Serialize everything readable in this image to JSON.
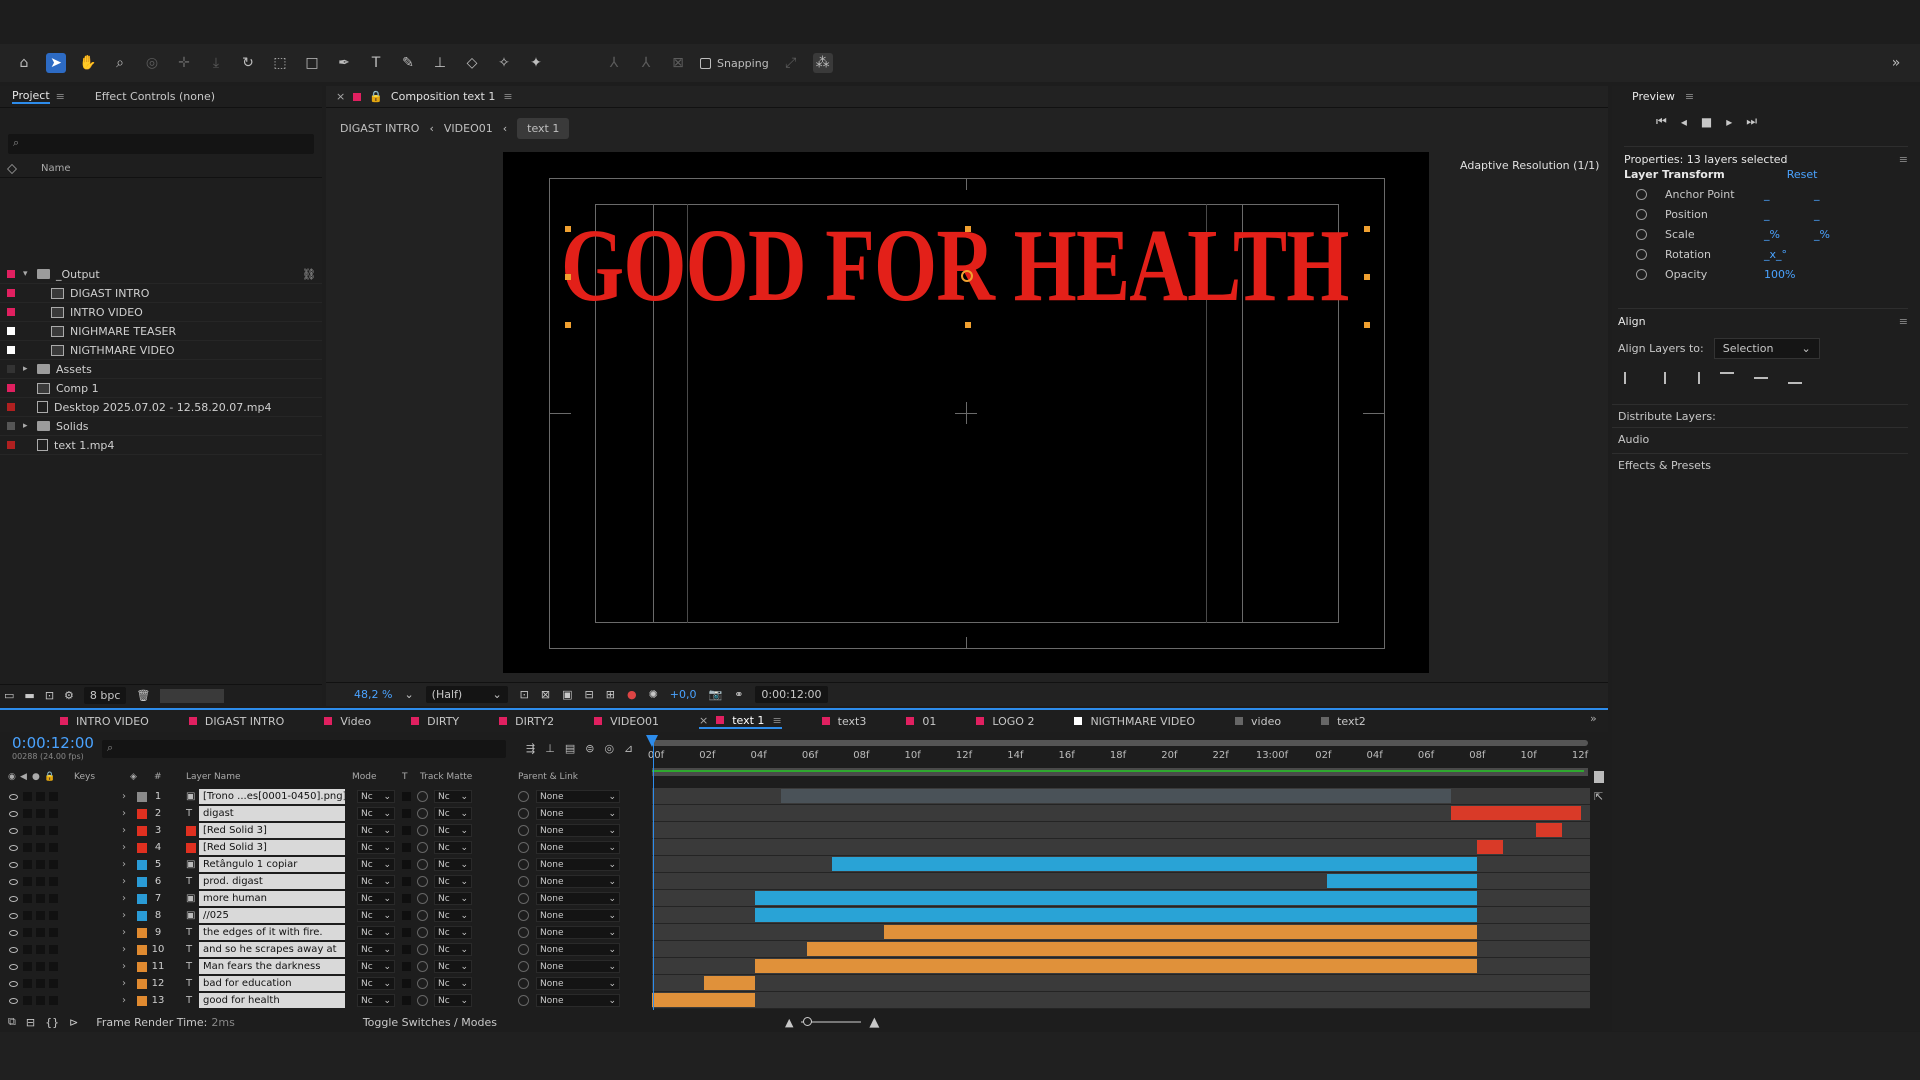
{
  "toolbar": {
    "snapping_label": "Snapping",
    "tools": [
      "home-icon",
      "selection-arrow-icon",
      "hand-icon",
      "zoom-icon",
      "orbit-icon",
      "pan-behind-icon",
      "dolly-icon",
      "rotate-icon",
      "region-icon",
      "rectangle-icon",
      "pen-icon",
      "type-icon",
      "brush-icon",
      "clone-stamp-icon",
      "eraser-icon",
      "roto-brush-icon",
      "puppet-pin-icon"
    ]
  },
  "project_panel": {
    "tabs": [
      "Project",
      "Effect Controls (none)"
    ],
    "name_header": "Name",
    "items": [
      {
        "name": "_Output",
        "type": "folder",
        "color": "#e02060",
        "expanded": true
      },
      {
        "name": "DIGAST INTRO",
        "type": "comp",
        "color": "#e02060",
        "indent": true
      },
      {
        "name": "INTRO VIDEO",
        "type": "comp",
        "color": "#e02060",
        "indent": true
      },
      {
        "name": "NIGHMARE TEASER",
        "type": "comp",
        "color": "#ffffff",
        "indent": true
      },
      {
        "name": "NIGTHMARE VIDEO",
        "type": "comp",
        "color": "#ffffff",
        "indent": true
      },
      {
        "name": "Assets",
        "type": "folder",
        "color": "#333333"
      },
      {
        "name": "Comp 1",
        "type": "comp",
        "color": "#e02060"
      },
      {
        "name": "Desktop 2025.07.02 - 12.58.20.07.mp4",
        "type": "file",
        "color": "#b02020"
      },
      {
        "name": "Solids",
        "type": "folder",
        "color": "#555555"
      },
      {
        "name": "text 1.mp4",
        "type": "file",
        "color": "#b02020"
      }
    ],
    "bpc": "8 bpc"
  },
  "composition": {
    "tab_title": "Composition text 1",
    "breadcrumbs": [
      "DIGAST INTRO",
      "VIDEO01",
      "text 1"
    ],
    "headline": "GOOD FOR HEALTH",
    "adaptive_resolution": "Adaptive Resolution (1/1)",
    "zoom": "48,2 %",
    "resolution": "(Half)",
    "exposure": "+0,0",
    "timecode": "0:00:12:00",
    "headline_color": "#e32019"
  },
  "preview": {
    "title": "Preview"
  },
  "properties": {
    "title": "Properties: 13 layers selected",
    "section": "Layer Transform",
    "reset": "Reset",
    "rows": [
      {
        "label": "Anchor Point",
        "v1": "_",
        "v2": "_"
      },
      {
        "label": "Position",
        "v1": "_",
        "v2": "_"
      },
      {
        "label": "Scale",
        "v1": "_%",
        "v2": "_%"
      },
      {
        "label": "Rotation",
        "v1": "_x_°",
        "v2": ""
      },
      {
        "label": "Opacity",
        "v1": "100%",
        "v2": ""
      }
    ]
  },
  "align": {
    "title": "Align",
    "align_layers_to": "Align Layers to:",
    "selection": "Selection",
    "distribute": "Distribute Layers:",
    "audio": "Audio",
    "effects": "Effects & Presets"
  },
  "timeline": {
    "tabs": [
      {
        "label": "INTRO VIDEO",
        "color": "#e02060"
      },
      {
        "label": "DIGAST INTRO",
        "color": "#e02060"
      },
      {
        "label": "Video",
        "color": "#e02060"
      },
      {
        "label": "DIRTY",
        "color": "#e02060"
      },
      {
        "label": "DIRTY2",
        "color": "#e02060"
      },
      {
        "label": "VIDEO01",
        "color": "#e02060"
      },
      {
        "label": "text 1",
        "color": "#e02060",
        "active": true
      },
      {
        "label": "text3",
        "color": "#e02060"
      },
      {
        "label": "01",
        "color": "#e02060"
      },
      {
        "label": "LOGO 2",
        "color": "#e02060"
      },
      {
        "label": "NIGTHMARE VIDEO",
        "color": "#ffffff"
      },
      {
        "label": "video",
        "color": "#666666"
      },
      {
        "label": "text2",
        "color": "#666666"
      }
    ],
    "timecode": "0:00:12:00",
    "fps": "00288 (24.00 fps)",
    "columns": {
      "keys": "Keys",
      "num": "#",
      "layer_name": "Layer Name",
      "mode": "Mode",
      "t": "T",
      "track_matte": "Track Matte",
      "parent": "Parent & Link"
    },
    "ruler": [
      "00f",
      "02f",
      "04f",
      "06f",
      "08f",
      "10f",
      "12f",
      "14f",
      "16f",
      "18f",
      "20f",
      "22f",
      "13:00f",
      "02f",
      "04f",
      "06f",
      "08f",
      "10f",
      "12f"
    ],
    "layers": [
      {
        "num": "1",
        "name": "[Trono ...es[0001-0450].png]",
        "type": "img",
        "color": "#8a8a8a",
        "start": 0.137,
        "end": 0.852,
        "bar": "#4a5258"
      },
      {
        "num": "2",
        "name": "digast",
        "type": "T",
        "color": "#e03020",
        "start": 0.852,
        "end": 0.99,
        "bar": "#d93a28"
      },
      {
        "num": "3",
        "name": "[Red Solid 3]",
        "type": "solid",
        "color": "#e03020",
        "start": 0.942,
        "end": 0.97,
        "bar": "#d93a28"
      },
      {
        "num": "4",
        "name": "[Red Solid 3]",
        "type": "solid",
        "color": "#e03020",
        "start": 0.88,
        "end": 0.907,
        "bar": "#d93a28"
      },
      {
        "num": "5",
        "name": "Retângulo 1 copiar",
        "type": "img",
        "color": "#2a9bd6",
        "start": 0.192,
        "end": 0.88,
        "bar": "#29a3d6"
      },
      {
        "num": "6",
        "name": "prod.        digast",
        "type": "T",
        "color": "#2a9bd6",
        "start": 0.72,
        "end": 0.88,
        "bar": "#29a3d6"
      },
      {
        "num": "7",
        "name": "more human",
        "type": "img",
        "color": "#2a9bd6",
        "start": 0.11,
        "end": 0.88,
        "bar": "#29a3d6"
      },
      {
        "num": "8",
        "name": "//025",
        "type": "img",
        "color": "#2a9bd6",
        "start": 0.11,
        "end": 0.88,
        "bar": "#29a3d6"
      },
      {
        "num": "9",
        "name": "the edges of it with fire.",
        "type": "T",
        "color": "#e08a30",
        "start": 0.247,
        "end": 0.88,
        "bar": "#e0913a"
      },
      {
        "num": "10",
        "name": "and so he scrapes away at",
        "type": "T",
        "color": "#e08a30",
        "start": 0.165,
        "end": 0.88,
        "bar": "#e0913a"
      },
      {
        "num": "11",
        "name": "Man fears the darkness",
        "type": "T",
        "color": "#e08a30",
        "start": 0.11,
        "end": 0.88,
        "bar": "#e0913a"
      },
      {
        "num": "12",
        "name": "bad for education",
        "type": "T",
        "color": "#e08a30",
        "start": 0.055,
        "end": 0.11,
        "bar": "#e0913a"
      },
      {
        "num": "13",
        "name": "good for health",
        "type": "T",
        "color": "#e08a30",
        "start": 0.0,
        "end": 0.11,
        "bar": "#e0913a"
      }
    ],
    "mode_value": "Nc",
    "matte_value": "Nc",
    "parent_value": "None",
    "frame_render": "Frame Render Time:",
    "frame_render_value": "2ms",
    "toggle": "Toggle Switches / Modes"
  }
}
